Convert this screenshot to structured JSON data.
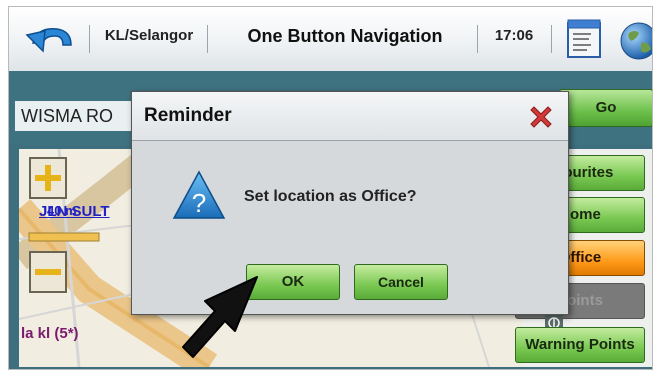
{
  "topbar": {
    "region": "KL/Selangor",
    "title": "One Button Navigation",
    "time": "17:06",
    "icons": [
      "back-arrow-icon",
      "menu-list-icon",
      "globe-icon"
    ]
  },
  "search": {
    "text": "WISMA RO",
    "go_label": "Go"
  },
  "sidebar": {
    "items": [
      {
        "label": "avourites"
      },
      {
        "label": "Home"
      },
      {
        "label": "Office"
      },
      {
        "label": "Points"
      },
      {
        "label": "Warning Points"
      }
    ]
  },
  "map": {
    "street_label": "JLN SULT",
    "speed_label": "40 m",
    "place_label": "la kl (5*)"
  },
  "dialog": {
    "title": "Reminder",
    "message": "Set location as Office?",
    "ok_label": "OK",
    "cancel_label": "Cancel"
  },
  "colors": {
    "header_bg": "#eef1f3",
    "teal_bg": "#3f7281",
    "button_green": "#79c852",
    "button_orange": "#ff9a1a",
    "close_red": "#d23a3a",
    "question_blue": "#2b8fd6"
  }
}
